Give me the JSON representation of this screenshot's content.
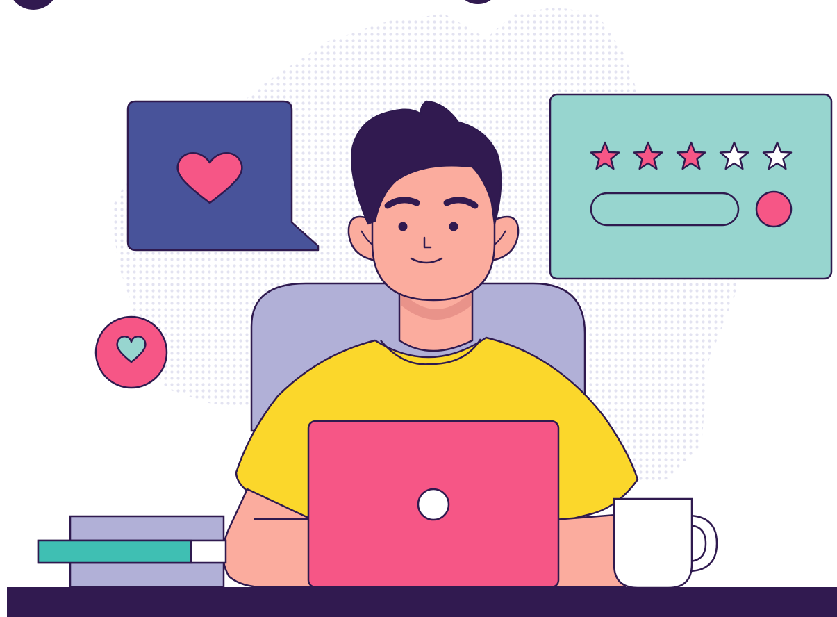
{
  "scene": "person-reviewing-on-laptop",
  "colors": {
    "outline": "#2f1a4f",
    "desk": "#311a50",
    "dots": "#e3e3f1",
    "chat_bubble": "#48539a",
    "heart_pink": "#f65686",
    "review_card": "#97d5cf",
    "star_filled": "#f65686",
    "star_empty": "#ffffff",
    "skin": "#fbac9e",
    "skin_shadow": "#e9938a",
    "hair": "#311a50",
    "shirt": "#fbd72b",
    "chair": "#b1b0d7",
    "laptop": "#f65686",
    "book_lavender": "#b1b0d7",
    "book_teal": "#3fbfb3",
    "mug": "#ffffff"
  },
  "rating": {
    "filled_stars": 3,
    "total_stars": 5
  },
  "icons": {
    "chat": "heart-chat-bubble-icon",
    "badge": "heart-badge-icon",
    "stars": "star-icon"
  }
}
